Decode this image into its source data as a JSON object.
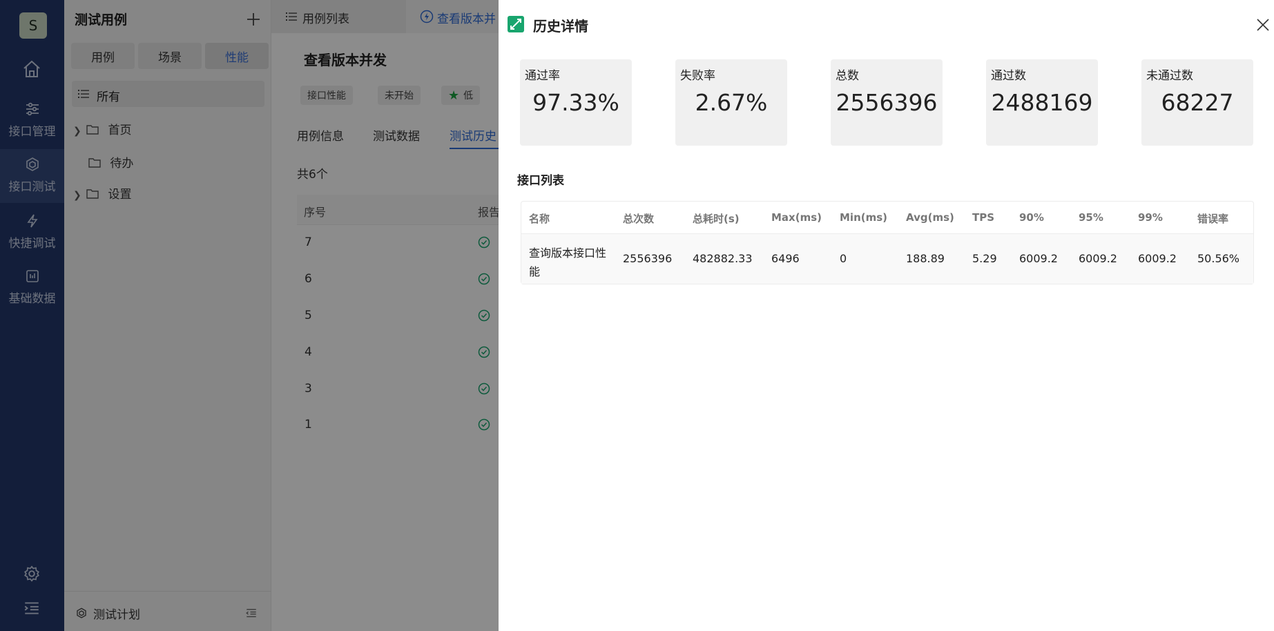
{
  "rail": {
    "avatar": "S",
    "items": [
      {
        "label": "接口管理"
      },
      {
        "label": "接口测试"
      },
      {
        "label": "快捷调试"
      },
      {
        "label": "基础数据"
      }
    ]
  },
  "tree": {
    "title": "测试用例",
    "segments": [
      "用例",
      "场景",
      "性能"
    ],
    "all_label": "所有",
    "nodes": [
      "首页",
      "待办",
      "设置"
    ],
    "footer": "测试计划"
  },
  "main": {
    "tabs": [
      "用例列表",
      "查看版本并"
    ],
    "case_title": "查看版本并发",
    "tags": [
      "接口性能",
      "未开始",
      "低"
    ],
    "subtabs": [
      "用例信息",
      "测试数据",
      "测试历史"
    ],
    "count": "共6个",
    "table_headers": [
      "序号",
      "报告"
    ],
    "rows": [
      "7",
      "6",
      "5",
      "4",
      "3",
      "1"
    ]
  },
  "drawer": {
    "title": "历史详情",
    "stats": [
      {
        "label": "通过率",
        "value": "97.33%"
      },
      {
        "label": "失败率",
        "value": "2.67%"
      },
      {
        "label": "总数",
        "value": "2556396"
      },
      {
        "label": "通过数",
        "value": "2488169"
      },
      {
        "label": "未通过数",
        "value": "68227"
      }
    ],
    "section_title": "接口列表",
    "columns": [
      "名称",
      "总次数",
      "总耗时(s)",
      "Max(ms)",
      "Min(ms)",
      "Avg(ms)",
      "TPS",
      "90%",
      "95%",
      "99%",
      "错误率"
    ],
    "row": [
      "查询版本接口性能",
      "2556396",
      "482882.33",
      "6496",
      "0",
      "188.89",
      "5.29",
      "6009.2",
      "6009.2",
      "6009.2",
      "50.56%"
    ]
  },
  "colors": {
    "rail": "#24386b",
    "accent": "#2f6bd6",
    "success": "#19a56e",
    "star": "#1aa340"
  }
}
